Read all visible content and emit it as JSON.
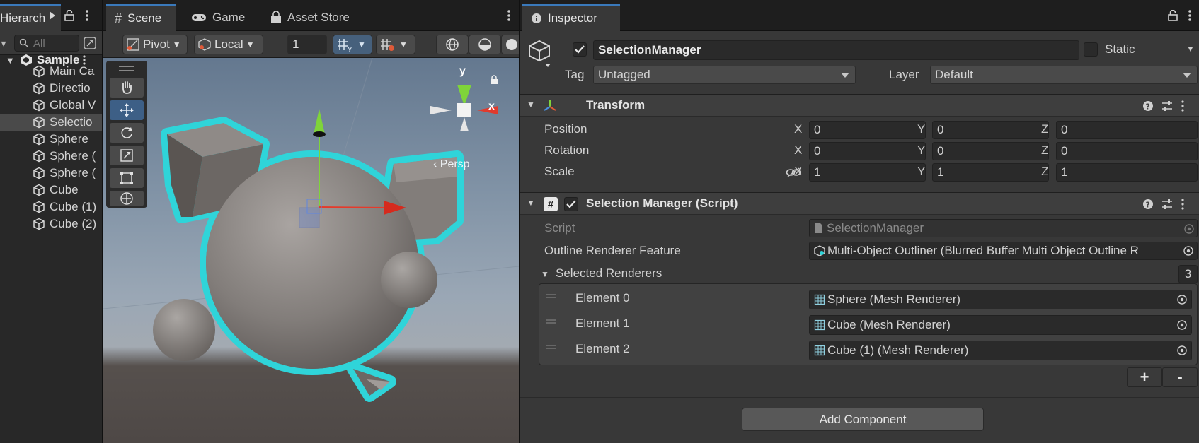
{
  "hierarchy": {
    "tab_label": "Hierarch",
    "search_placeholder": "All",
    "scene_name": "Sample",
    "items": [
      "Main Ca",
      "Directio",
      "Global V",
      "Selectio",
      "Sphere",
      "Sphere (",
      "Sphere (",
      "Cube",
      "Cube (1)",
      "Cube (2)"
    ],
    "selected_index": 3
  },
  "scene": {
    "tabs": [
      "Scene",
      "Game",
      "Asset Store"
    ],
    "toolbar": {
      "pivot": "Pivot",
      "local": "Local",
      "grid_size": "1"
    },
    "gizmo": {
      "y": "y",
      "x": "x",
      "projection": "‹ Persp"
    }
  },
  "inspector": {
    "tab_label": "Inspector",
    "object_name": "SelectionManager",
    "active": true,
    "static_label": "Static",
    "tag_label": "Tag",
    "tag_value": "Untagged",
    "layer_label": "Layer",
    "layer_value": "Default",
    "transform": {
      "title": "Transform",
      "rows": [
        {
          "label": "Position",
          "x": "0",
          "y": "0",
          "z": "0"
        },
        {
          "label": "Rotation",
          "x": "0",
          "y": "0",
          "z": "0"
        },
        {
          "label": "Scale",
          "x": "1",
          "y": "1",
          "z": "1"
        }
      ],
      "axis_labels": [
        "X",
        "Y",
        "Z"
      ]
    },
    "script_component": {
      "title": "Selection Manager (Script)",
      "script_label": "Script",
      "script_value": "SelectionManager",
      "outline_label": "Outline Renderer Feature",
      "outline_value": "Multi-Object Outliner (Blurred Buffer Multi Object Outline R",
      "list_label": "Selected Renderers",
      "list_count": "3",
      "elements": [
        {
          "label": "Element 0",
          "value": "Sphere (Mesh Renderer)"
        },
        {
          "label": "Element 1",
          "value": "Cube (Mesh Renderer)"
        },
        {
          "label": "Element 2",
          "value": "Cube (1) (Mesh Renderer)"
        }
      ],
      "add_label": "+",
      "remove_label": "-"
    },
    "add_component": "Add Component"
  },
  "colors": {
    "outline": "#2fd4d9",
    "accent": "#3a79bb",
    "selection": "#4a4a4a"
  }
}
